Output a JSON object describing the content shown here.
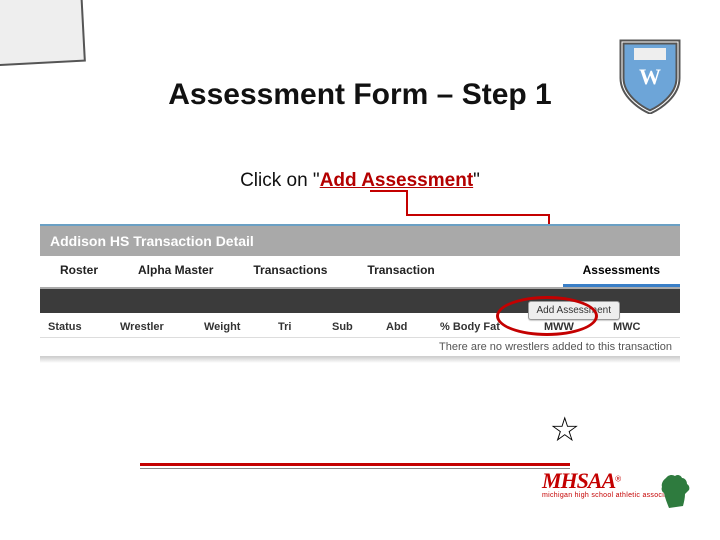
{
  "title": "Assessment Form – Step 1",
  "subtitle_pre": "Click on \"",
  "subtitle_em": "Add Assessment",
  "subtitle_post": "\"",
  "panel": {
    "header": "Addison HS Transaction Detail",
    "tabs": [
      "Roster",
      "Alpha Master",
      "Transactions",
      "Transaction",
      "Assessments"
    ],
    "selected_tab_index": 4,
    "button_label": "Add Assessment",
    "columns": [
      "Status",
      "Wrestler",
      "Weight",
      "Tri",
      "Sub",
      "Abd",
      "% Body Fat",
      "MWW",
      "MWC"
    ],
    "empty_message": "There are no wrestlers added to this transaction"
  },
  "shield_letter": "W",
  "footer": {
    "brand": "MHSAA",
    "tagline": "michigan high school athletic association"
  },
  "star_glyph": "☆"
}
